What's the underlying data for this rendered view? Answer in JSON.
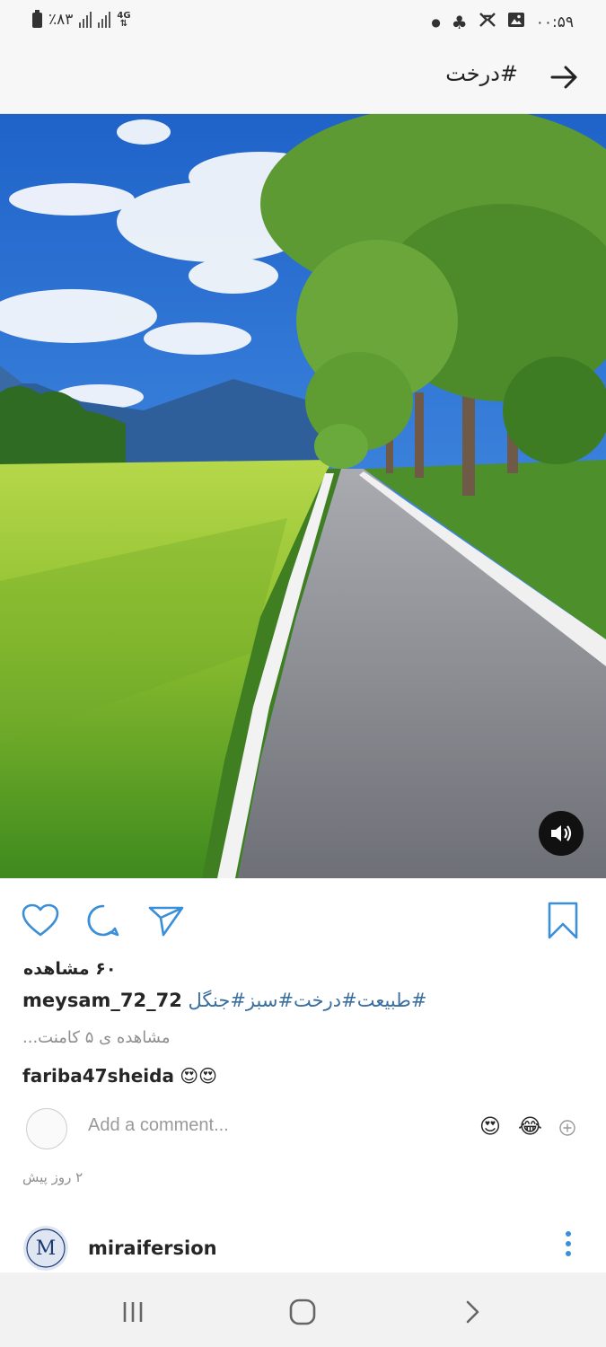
{
  "status_bar": {
    "battery_text": "٪۸۳",
    "network_label": "4G",
    "time": "۰۰:۵۹",
    "icons": [
      "battery-icon",
      "signal-icon",
      "signal-icon",
      "network-4g-icon",
      "dot-icon",
      "club-icon",
      "notification-icon",
      "gallery-icon"
    ]
  },
  "header": {
    "title": "#درخت",
    "back_icon": "arrow-right-icon"
  },
  "media": {
    "type": "video",
    "sound_icon": "speaker-icon"
  },
  "actions": {
    "icons": [
      "heart-icon",
      "comment-icon",
      "send-icon",
      "bookmark-icon"
    ]
  },
  "post": {
    "views": "۶۰ مشاهده",
    "username": "meysam_72_72",
    "caption_tags": "#طبیعت#درخت#سبز#جنگل",
    "view_comments": "مشاهده ی ۵ کامنت...",
    "comments": [
      {
        "username": "fariba47sheida",
        "text": "😍😍"
      }
    ],
    "add_comment_placeholder": "Add a comment...",
    "quick_emojis": [
      "😍",
      "😂"
    ],
    "timestamp": "۲ روز پیش"
  },
  "next_post": {
    "username": "miraifersion",
    "avatar_text": "M"
  },
  "nav_bar": {
    "icons": [
      "recent-apps-icon",
      "home-icon",
      "back-icon"
    ]
  },
  "colors": {
    "link_blue": "#3a6fa0",
    "icon_blue": "#3b8fd8",
    "muted_gray": "#8e8e8e"
  }
}
